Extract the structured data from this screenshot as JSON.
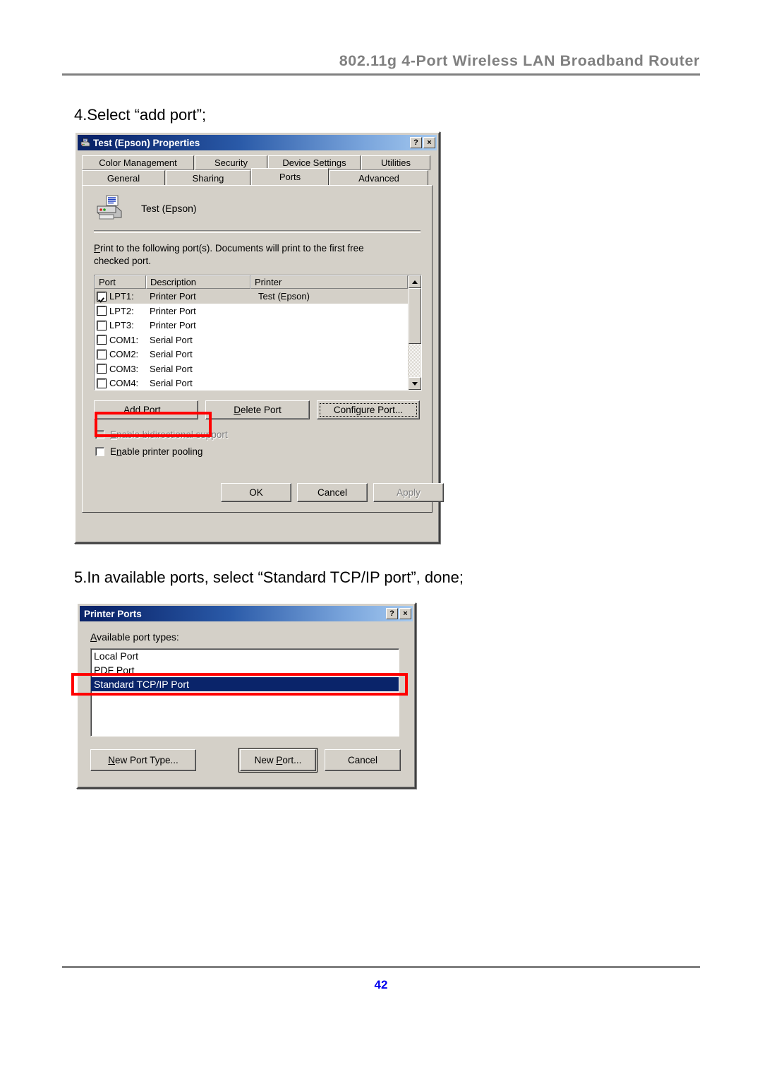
{
  "page": {
    "header_title": "802.11g 4-Port Wireless LAN Broadband Router",
    "page_number": "42",
    "accent_color": "#0000ee",
    "rule_color": "#808080",
    "highlight_color": "#ff0000"
  },
  "steps": {
    "step4": "4.Select “add port”;",
    "step5": "5.In available ports, select “Standard TCP/IP port”, done;"
  },
  "printer_properties_dialog": {
    "title": "Test (Epson) Properties",
    "title_icon": "printer-icon",
    "help_button": "?",
    "close_button": "×",
    "tabs_row1": [
      {
        "label": "Color Management",
        "selected": false
      },
      {
        "label": "Security",
        "selected": false
      },
      {
        "label": "Device Settings",
        "selected": false
      },
      {
        "label": "Utilities",
        "selected": false
      }
    ],
    "tabs_row2": [
      {
        "label": "General",
        "selected": false
      },
      {
        "label": "Sharing",
        "selected": false
      },
      {
        "label": "Ports",
        "selected": true
      },
      {
        "label": "Advanced",
        "selected": false
      }
    ],
    "printer_name": "Test (Epson)",
    "instruction_line1_prefix": "P",
    "instruction_line1": "rint to the following port(s). Documents will print to the first free",
    "instruction_line2": "checked port.",
    "port_table": {
      "columns": [
        "Port",
        "Description",
        "Printer"
      ],
      "rows": [
        {
          "checked": true,
          "port": "LPT1:",
          "description": "Printer Port",
          "printer": "Test (Epson)",
          "selected": true
        },
        {
          "checked": false,
          "port": "LPT2:",
          "description": "Printer Port",
          "printer": "",
          "selected": false
        },
        {
          "checked": false,
          "port": "LPT3:",
          "description": "Printer Port",
          "printer": "",
          "selected": false
        },
        {
          "checked": false,
          "port": "COM1:",
          "description": "Serial Port",
          "printer": "",
          "selected": false
        },
        {
          "checked": false,
          "port": "COM2:",
          "description": "Serial Port",
          "printer": "",
          "selected": false
        },
        {
          "checked": false,
          "port": "COM3:",
          "description": "Serial Port",
          "printer": "",
          "selected": false
        },
        {
          "checked": false,
          "port": "COM4:",
          "description": "Serial Port",
          "printer": "",
          "selected": false
        }
      ],
      "scrollbar": {
        "up_arrow": "scroll-up-icon",
        "down_arrow": "scroll-down-icon",
        "thumb_fraction": 0.62
      }
    },
    "port_buttons": {
      "add_port": {
        "label_pre": "Add Por",
        "accel": "t",
        "label_post": "...",
        "highlighted": true
      },
      "delete_port": {
        "accel": "D",
        "label_post": "elete Port"
      },
      "configure_port": {
        "label_pre": "Confi",
        "accel": "g",
        "label_post": "ure Port...",
        "focused": true
      }
    },
    "checkboxes": [
      {
        "label_pre": "",
        "accel": "E",
        "label_post": "nable bidirectional support",
        "checked": false,
        "disabled": true
      },
      {
        "label_pre": "E",
        "accel": "n",
        "label_post": "able printer pooling",
        "checked": false,
        "disabled": false
      }
    ],
    "footer_buttons": [
      {
        "label": "OK",
        "disabled": false
      },
      {
        "label": "Cancel",
        "disabled": false
      },
      {
        "label": "Apply",
        "accel": "A",
        "disabled": true
      }
    ]
  },
  "printer_ports_dialog": {
    "title": "Printer Ports",
    "help_button": "?",
    "close_button": "×",
    "list_label_accel": "A",
    "list_label_rest": "vailable port types:",
    "port_types": [
      {
        "label": "Local Port",
        "selected": false
      },
      {
        "label": "PDF Port",
        "selected": false
      },
      {
        "label": "Standard TCP/IP Port",
        "selected": true
      }
    ],
    "buttons": {
      "new_port_type": {
        "accel": "N",
        "label_post": "ew Port Type..."
      },
      "new_port": {
        "label_pre": "New ",
        "accel": "P",
        "label_post": "ort...",
        "default": true
      },
      "cancel": {
        "label": "Cancel"
      }
    }
  }
}
